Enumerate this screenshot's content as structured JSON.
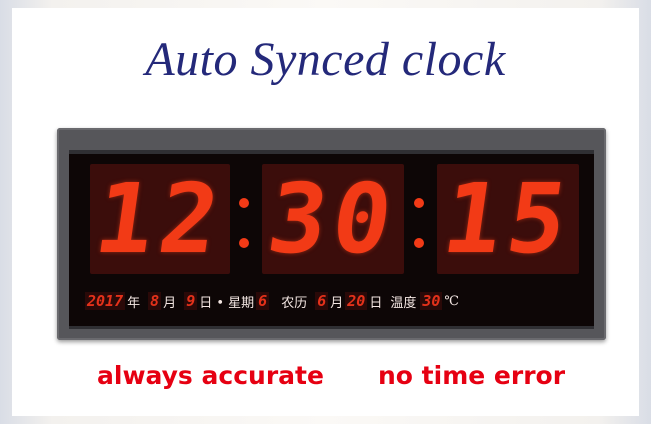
{
  "title": "Auto Synced clock",
  "clock": {
    "hours": "12",
    "minutes": "30",
    "seconds": "15",
    "date_row": {
      "year": "2017",
      "year_unit": "年",
      "month": "8",
      "month_unit": "月",
      "day": "9",
      "day_unit": "日 • 星期",
      "weekday": "6",
      "lunar_label": "农历",
      "lunar_month": "6",
      "lunar_month_unit": "月",
      "lunar_day": "20",
      "lunar_day_unit": "日",
      "temp_label": "温度",
      "temp": "30",
      "temp_unit": "℃"
    }
  },
  "taglines": {
    "left": "always  accurate",
    "right": "no time error"
  },
  "colors": {
    "title": "#24297a",
    "led": "#f23a16",
    "tagline": "#e60012"
  }
}
